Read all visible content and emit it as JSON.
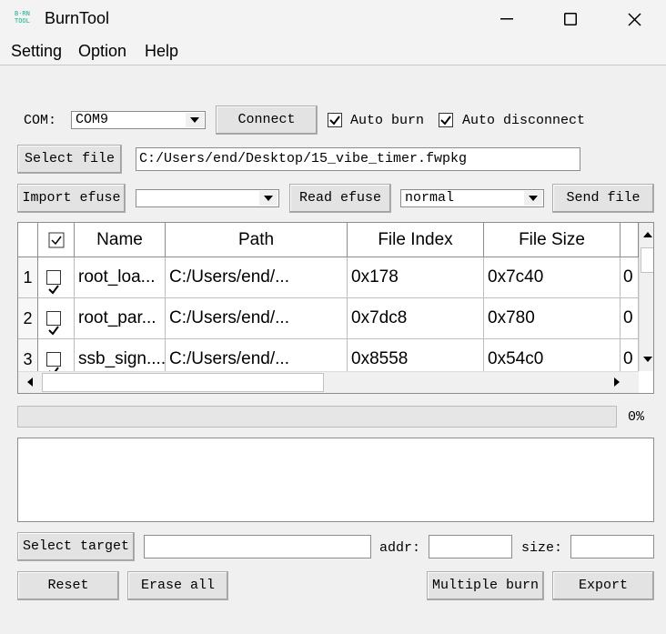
{
  "window": {
    "title": "BurnTool",
    "logo_text": "BURN TOOL"
  },
  "menu": [
    "Setting",
    "Option",
    "Help"
  ],
  "com": {
    "label": "COM:",
    "value": "COM9",
    "connect_label": "Connect"
  },
  "auto_burn": {
    "label": "Auto burn",
    "checked": true
  },
  "auto_disconnect": {
    "label": "Auto disconnect",
    "checked": true
  },
  "file": {
    "select_label": "Select file",
    "path": "C:/Users/end/Desktop/15_vibe_timer.fwpkg"
  },
  "efuse": {
    "import_label": "Import efuse",
    "combo_value": "",
    "read_label": "Read efuse",
    "mode_value": "normal",
    "send_label": "Send file"
  },
  "table": {
    "columns": [
      "Name",
      "Path",
      "File Index",
      "File Size"
    ],
    "rows": [
      {
        "num": "1",
        "checked": true,
        "name": "root_loa...",
        "path": "C:/Users/end/...",
        "index": "0x178",
        "size": "0x7c40",
        "extra": "0"
      },
      {
        "num": "2",
        "checked": true,
        "name": "root_par...",
        "path": "C:/Users/end/...",
        "index": "0x7dc8",
        "size": "0x780",
        "extra": "0"
      },
      {
        "num": "3",
        "checked": true,
        "name": "ssb_sign....",
        "path": "C:/Users/end/...",
        "index": "0x8558",
        "size": "0x54c0",
        "extra": "0"
      }
    ]
  },
  "progress": {
    "value": 0,
    "label": "0%"
  },
  "log": {
    "text": ""
  },
  "target": {
    "select_label": "Select target",
    "value": "",
    "addr_label": "addr:",
    "addr_value": "",
    "size_label": "size:",
    "size_value": ""
  },
  "bottom": {
    "reset_label": "Reset",
    "erase_label": "Erase all",
    "multiple_label": "Multiple burn",
    "export_label": "Export"
  }
}
